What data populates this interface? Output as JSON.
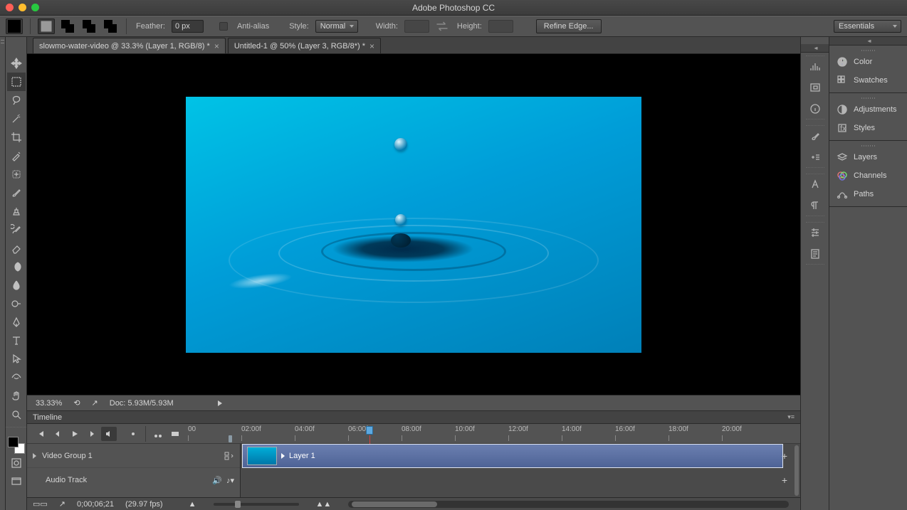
{
  "app": {
    "title": "Adobe Photoshop CC"
  },
  "optionsBar": {
    "featherLabel": "Feather:",
    "featherValue": "0 px",
    "antiAliasLabel": "Anti-alias",
    "styleLabel": "Style:",
    "styleValue": "Normal",
    "widthLabel": "Width:",
    "heightLabel": "Height:",
    "refineEdge": "Refine Edge...",
    "workspace": "Essentials"
  },
  "tabs": [
    {
      "label": "slowmo-water-video @ 33.3% (Layer 1, RGB/8) *",
      "active": true
    },
    {
      "label": "Untitled-1 @ 50% (Layer 3, RGB/8*) *",
      "active": false
    }
  ],
  "status": {
    "zoom": "33.33%",
    "docInfo": "Doc: 5.93M/5.93M"
  },
  "panels": {
    "color": "Color",
    "swatches": "Swatches",
    "adjustments": "Adjustments",
    "styles": "Styles",
    "layers": "Layers",
    "channels": "Channels",
    "paths": "Paths"
  },
  "timeline": {
    "title": "Timeline",
    "ruler": [
      "00",
      "02:00f",
      "04:00f",
      "06:00f",
      "08:00f",
      "10:00f",
      "12:00f",
      "14:00f",
      "16:00f",
      "18:00f",
      "20:00f"
    ],
    "videoGroup": "Video Group 1",
    "clipName": "Layer 1",
    "audioTrack": "Audio Track",
    "timecode": "0;00;06;21",
    "fps": "(29.97 fps)"
  }
}
